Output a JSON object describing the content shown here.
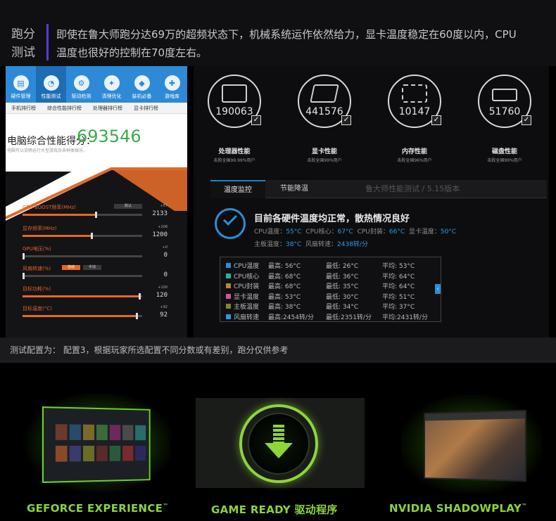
{
  "banner": {
    "label_line1": "跑分",
    "label_line2": "测试",
    "text": "即使在鲁大师跑分达69万的超频状态下，机械系统运作依然给力，显卡温度稳定在60度以内，CPU温度也很好的控制在70度左右。"
  },
  "app": {
    "toolbar": [
      {
        "label": "硬件管理"
      },
      {
        "label": "性能测试"
      },
      {
        "label": "驱动检测"
      },
      {
        "label": "清理优化"
      },
      {
        "label": "装机必备"
      },
      {
        "label": "游戏库"
      }
    ],
    "subtabs": [
      "手机排行榜",
      "综合性能排行榜",
      "处理器排行榜",
      "显卡排行榜"
    ],
    "score_label": "电脑综合性能得分：",
    "score": "693546",
    "score_note": "电脑可以流畅运行大型游戏及各种类娱乐。",
    "msi": {
      "rows": [
        {
          "label": "GPU BOOST频率(MHz)",
          "value": "2133",
          "plus": "+57",
          "fill": 0.62
        },
        {
          "label": "显存频率(MHz)",
          "value": "1200",
          "plus": "+208",
          "fill": 0.58
        },
        {
          "label": "GPU电压(%)",
          "value": "0",
          "plus": "+0",
          "fill": 0.0
        },
        {
          "label": "风扇转速(%)",
          "value": "0",
          "plus": "",
          "fill": 0.0
        },
        {
          "label": "目标功耗(%)",
          "value": "120",
          "plus": "+100",
          "fill": 0.98
        },
        {
          "label": "目标温度(°C)",
          "value": "92",
          "plus": "+92",
          "fill": 0.96
        }
      ],
      "btn_default": "默认",
      "btn_auto": "自动",
      "btn_manual": "手动"
    }
  },
  "panel": {
    "categories": [
      {
        "name": "处理器性能",
        "score": "190063",
        "sub": "击败全国99.99%用户",
        "icon": "monitor-icon"
      },
      {
        "name": "显卡性能",
        "score": "441576",
        "sub": "击败全国99%用户",
        "icon": "gpu-cube-icon"
      },
      {
        "name": "内存性能",
        "score": "10147",
        "sub": "击败全国96%用户",
        "icon": "memory-icon"
      },
      {
        "name": "磁盘性能",
        "score": "51760",
        "sub": "击败全国99%用户",
        "icon": "disk-icon"
      }
    ],
    "check_glyph": "✓",
    "tabs": [
      "温度监控",
      "节能降温"
    ],
    "tab_title": "鲁大师性能测试 / 5.15版本",
    "status_head": "目前各硬件温度均正常，散热情况良好",
    "status_line1": [
      {
        "k": "CPU温度：",
        "v": "55°C"
      },
      {
        "k": "CPU核心：",
        "v": "67°C"
      },
      {
        "k": "CPU封装：",
        "v": "66°C"
      },
      {
        "k": "显卡温度：",
        "v": "50°C"
      }
    ],
    "status_line2": [
      {
        "k": "主板温度：",
        "v": "38°C"
      },
      {
        "k": "风扇转速：",
        "v": "2438转/分"
      }
    ],
    "temps": [
      {
        "name": "CPU温度",
        "max": "最高: 56°C",
        "min": "最低: 26°C",
        "avg": "平均: 53°C",
        "color": "#2b8dd6"
      },
      {
        "name": "CPU核心",
        "max": "最高: 68°C",
        "min": "最低: 36°C",
        "avg": "平均: 64°C",
        "color": "#27b39a"
      },
      {
        "name": "CPU封装",
        "max": "最高: 68°C",
        "min": "最低: 35°C",
        "avg": "平均: 64°C",
        "color": "#b9862d"
      },
      {
        "name": "显卡温度",
        "max": "最高: 53°C",
        "min": "最低: 30°C",
        "avg": "平均: 51°C",
        "color": "#c85a9a"
      },
      {
        "name": "主板温度",
        "max": "最高: 38°C",
        "min": "最低: 34°C",
        "avg": "平均: 37°C",
        "color": "#7d8a2a"
      },
      {
        "name": "风扇转速",
        "max": "最高:2454转/分",
        "min": "最低:2351转/分",
        "avg": "平均:2431转/分",
        "color": "#2b9ae6"
      }
    ]
  },
  "note": "测试配置为：  配置3，根据玩家所选配置不同分数或有差别，跑分仅供参考",
  "features": [
    {
      "label": "GEFORCE EXPERIENCE",
      "tm": "™"
    },
    {
      "label": "GAME READY 驱动程序",
      "tm": ""
    },
    {
      "label": "NVIDIA SHADOWPLAY",
      "tm": "™"
    }
  ],
  "colors": {
    "accent_blue": "#2b8dd6",
    "msi_orange": "#e06a2a",
    "nvidia_green": "#8bd33c",
    "score_green": "#3bab4a"
  }
}
